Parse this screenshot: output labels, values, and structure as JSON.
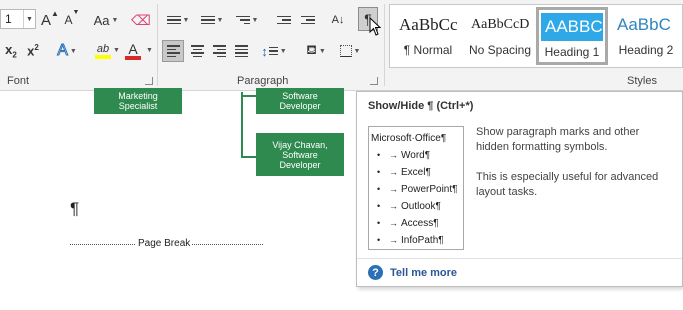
{
  "ribbon": {
    "font_group": {
      "label": "Font",
      "font_size": "1",
      "grow_font_glyph": "A",
      "shrink_font_glyph": "A",
      "change_case_glyph": "Aa",
      "subscript_glyph": "x",
      "subscript_sub": "2",
      "superscript_glyph": "x",
      "superscript_sup": "2",
      "text_effects_glyph": "A",
      "highlight_glyph": "ab",
      "font_color_glyph": "A",
      "highlight_color": "#ffff00",
      "font_color": "#d62b2b"
    },
    "paragraph_group": {
      "label": "Paragraph",
      "sort_glyph": "A↓",
      "pilcrow_glyph": "¶",
      "line_spacing_glyph": "↕"
    },
    "styles_group": {
      "label": "Styles",
      "items": [
        {
          "sample": "AaBbCc",
          "name": "¶ Normal"
        },
        {
          "sample": "AaBbCcD",
          "name": "No Spacing"
        },
        {
          "sample": "AABBC",
          "name": "Heading 1"
        },
        {
          "sample": "AaBbC",
          "name": "Heading 2"
        }
      ]
    }
  },
  "document": {
    "boxes": [
      {
        "line1": "Marketing",
        "line2": "Specialist",
        "line3": ""
      },
      {
        "line1": "Software",
        "line2": "Developer",
        "line3": ""
      },
      {
        "line1": "Vijay Chavan,",
        "line2": "Software",
        "line3": "Developer"
      }
    ],
    "paragraph_mark": "¶",
    "page_break_label": "Page Break"
  },
  "tooltip": {
    "title": "Show/Hide ¶ (Ctrl+*)",
    "preview": {
      "heading": "Microsoft·Office¶",
      "items": [
        "Word¶",
        "Excel¶",
        "PowerPoint¶",
        "Outlook¶",
        "Access¶",
        "InfoPath¶"
      ],
      "bullet_glyph": "•",
      "arrow_glyph": "→"
    },
    "description": "Show paragraph marks and other hidden formatting symbols.",
    "detail": "This is especially useful for advanced layout tasks.",
    "help_icon": "?",
    "help_link": "Tell me more"
  },
  "colors": {
    "org_box": "#2f8a4f",
    "selected_style": "#2ea8e6",
    "link": "#2b5797"
  }
}
